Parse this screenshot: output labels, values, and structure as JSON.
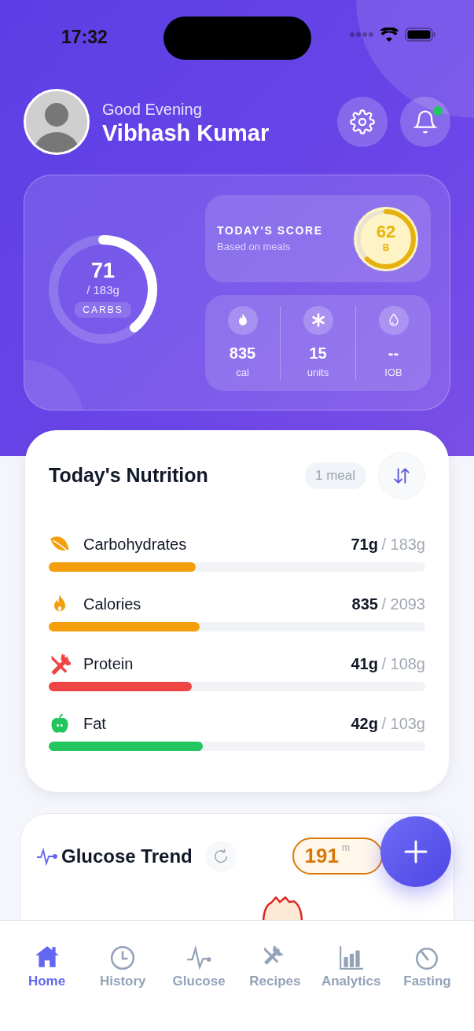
{
  "status_bar": {
    "time": "17:32"
  },
  "header": {
    "greeting": "Good Evening",
    "name": "Vibhash Kumar",
    "has_notification": true
  },
  "summary": {
    "carbs": {
      "value": "71",
      "target": "/ 183g",
      "label": "CARBS"
    },
    "score": {
      "title": "TODAY'S SCORE",
      "subtitle": "Based on meals",
      "value": "62",
      "grade": "B"
    },
    "stats": [
      {
        "kind": "flame",
        "value": "835",
        "unit": "cal"
      },
      {
        "kind": "asterisk",
        "value": "15",
        "unit": "units"
      },
      {
        "kind": "drop",
        "value": "--",
        "unit": "IOB"
      }
    ]
  },
  "nutrition": {
    "title": "Today's Nutrition",
    "meal_count": "1 meal",
    "items": [
      {
        "kind": "leaf",
        "name": "Carbohydrates",
        "amount": "71g",
        "target": "/ 183g",
        "level": 0.39,
        "color": "#f59e0b"
      },
      {
        "kind": "flame",
        "name": "Calories",
        "amount": "835",
        "target": "/ 2093",
        "level": 0.4,
        "color": "#f59e0b"
      },
      {
        "kind": "utensils",
        "name": "Protein",
        "amount": "41g",
        "target": "/ 108g",
        "level": 0.38,
        "color": "#ef4444"
      },
      {
        "kind": "apple",
        "name": "Fat",
        "amount": "42g",
        "target": "/ 103g",
        "level": 0.41,
        "color": "#22c55e"
      }
    ]
  },
  "glucose": {
    "title": "Glucose Trend",
    "reading": "191",
    "unit": "m"
  },
  "tabs": [
    {
      "kind": "home",
      "label": "Home",
      "selected": true
    },
    {
      "kind": "clock",
      "label": "History",
      "selected": false
    },
    {
      "kind": "pulse",
      "label": "Glucose",
      "selected": false
    },
    {
      "kind": "utensils",
      "label": "Recipes",
      "selected": false
    },
    {
      "kind": "chart",
      "label": "Analytics",
      "selected": false
    },
    {
      "kind": "timer",
      "label": "Fasting",
      "selected": false
    }
  ]
}
